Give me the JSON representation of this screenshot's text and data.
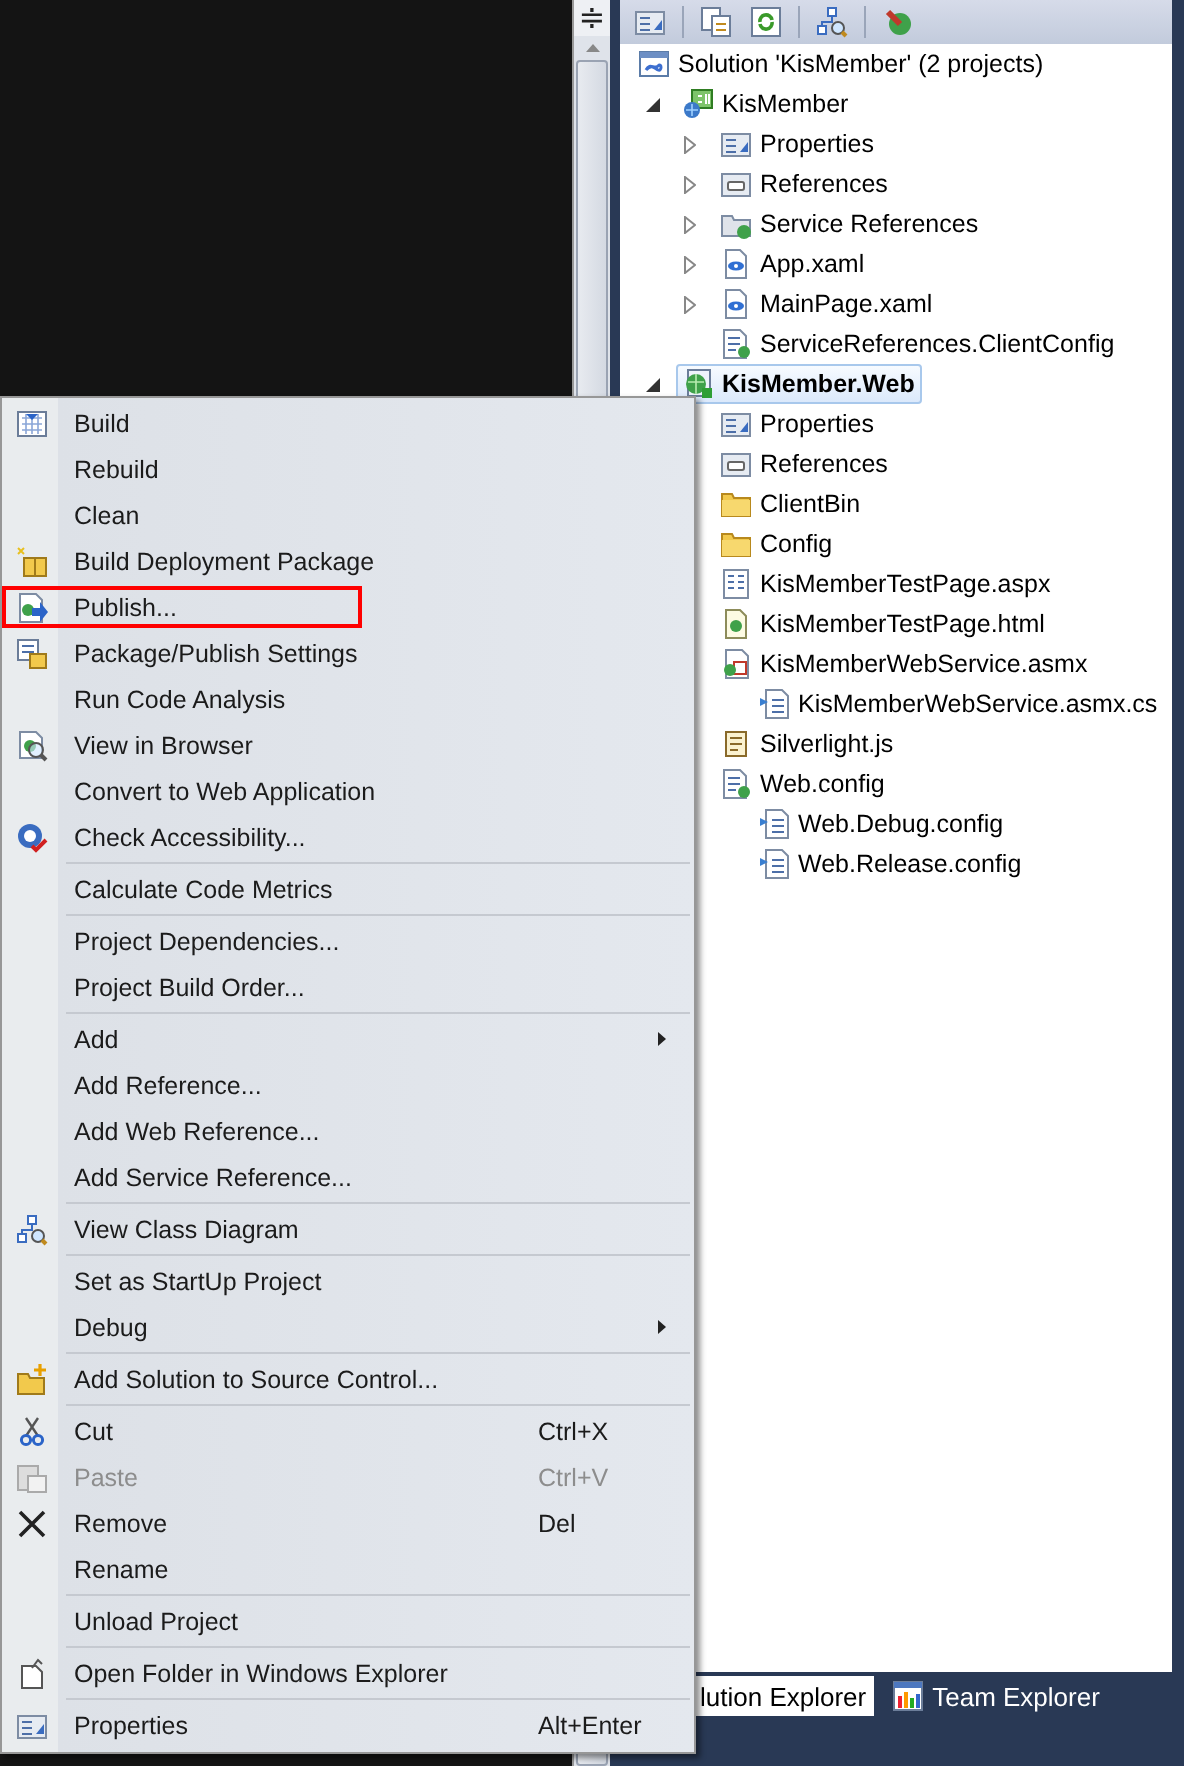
{
  "editor": {
    "splitter": "≑"
  },
  "solution_tree": {
    "items": [
      {
        "label": "Solution 'KisMember' (2 projects)",
        "kind": "solution",
        "selected": false,
        "startup": false,
        "children": [
          {
            "label": "KisMember",
            "kind": "cs-project",
            "selected": false,
            "startup": false,
            "expanded": true,
            "children": [
              {
                "label": "Properties",
                "kind": "properties",
                "selected": false,
                "startup": false,
                "expanded": false
              },
              {
                "label": "References",
                "kind": "references",
                "selected": false,
                "startup": false,
                "expanded": false
              },
              {
                "label": "Service References",
                "kind": "service-references",
                "selected": false,
                "startup": false,
                "expanded": false
              },
              {
                "label": "App.xaml",
                "kind": "xaml",
                "selected": false,
                "startup": false,
                "expanded": false
              },
              {
                "label": "MainPage.xaml",
                "kind": "xaml",
                "selected": false,
                "startup": false,
                "expanded": false
              },
              {
                "label": "ServiceReferences.ClientConfig",
                "kind": "config",
                "selected": false,
                "startup": false
              }
            ]
          },
          {
            "label": "KisMember.Web",
            "kind": "web-project",
            "selected": true,
            "startup": true,
            "expanded": true,
            "children": [
              {
                "label": "Properties",
                "kind": "properties",
                "selected": false,
                "startup": false
              },
              {
                "label": "References",
                "kind": "references",
                "selected": false,
                "startup": false
              },
              {
                "label": "ClientBin",
                "kind": "folder",
                "selected": false,
                "startup": false
              },
              {
                "label": "Config",
                "kind": "folder",
                "selected": false,
                "startup": false
              },
              {
                "label": "KisMemberTestPage.aspx",
                "kind": "aspx",
                "selected": false,
                "startup": false
              },
              {
                "label": "KisMemberTestPage.html",
                "kind": "html",
                "selected": false,
                "startup": false
              },
              {
                "label": "KisMemberWebService.asmx",
                "kind": "asmx",
                "selected": false,
                "startup": false,
                "children": [
                  {
                    "label": "KisMemberWebService.asmx.cs",
                    "kind": "code",
                    "selected": false,
                    "startup": false
                  }
                ]
              },
              {
                "label": "Silverlight.js",
                "kind": "script",
                "selected": false,
                "startup": false
              },
              {
                "label": "Web.config",
                "kind": "config",
                "selected": false,
                "startup": false,
                "children": [
                  {
                    "label": "Web.Debug.config",
                    "kind": "code",
                    "selected": false,
                    "startup": false
                  },
                  {
                    "label": "Web.Release.config",
                    "kind": "code",
                    "selected": false,
                    "startup": false
                  }
                ]
              }
            ]
          }
        ]
      }
    ]
  },
  "bottom_tabs": [
    {
      "label": "lution Explorer",
      "kind": "plain",
      "selected": true
    },
    {
      "label": "Team Explorer",
      "kind": "team",
      "selected": false
    }
  ],
  "context_menu": {
    "items": [
      {
        "kind": "build",
        "label": "Build",
        "disabled": false,
        "outlined": false
      },
      {
        "kind": "plain",
        "label": "Rebuild",
        "disabled": false,
        "outlined": false
      },
      {
        "kind": "plain",
        "label": "Clean",
        "disabled": false,
        "outlined": false
      },
      {
        "kind": "package",
        "label": "Build Deployment Package",
        "disabled": false,
        "outlined": false
      },
      {
        "kind": "publish",
        "label": "Publish...",
        "disabled": false,
        "outlined": true
      },
      {
        "kind": "package-settings",
        "label": "Package/Publish Settings",
        "disabled": false,
        "outlined": false
      },
      {
        "kind": "plain",
        "label": "Run Code Analysis",
        "disabled": false,
        "outlined": false
      },
      {
        "kind": "browser",
        "label": "View in Browser",
        "disabled": false,
        "outlined": false
      },
      {
        "kind": "plain",
        "label": "Convert to Web Application",
        "disabled": false,
        "outlined": false
      },
      {
        "kind": "accessibility",
        "label": "Check Accessibility...",
        "disabled": false,
        "outlined": false
      },
      {
        "kind": "separator"
      },
      {
        "kind": "plain",
        "label": "Calculate Code Metrics",
        "disabled": false,
        "outlined": false
      },
      {
        "kind": "separator"
      },
      {
        "kind": "plain",
        "label": "Project Dependencies...",
        "disabled": false,
        "outlined": false
      },
      {
        "kind": "plain",
        "label": "Project Build Order...",
        "disabled": false,
        "outlined": false
      },
      {
        "kind": "separator"
      },
      {
        "kind": "submenu",
        "label": "Add",
        "disabled": false,
        "outlined": false
      },
      {
        "kind": "plain",
        "label": "Add Reference...",
        "disabled": false,
        "outlined": false
      },
      {
        "kind": "plain",
        "label": "Add Web Reference...",
        "disabled": false,
        "outlined": false
      },
      {
        "kind": "plain",
        "label": "Add Service Reference...",
        "disabled": false,
        "outlined": false
      },
      {
        "kind": "separator"
      },
      {
        "kind": "class-diagram",
        "label": "View Class Diagram",
        "disabled": false,
        "outlined": false
      },
      {
        "kind": "separator"
      },
      {
        "kind": "plain",
        "label": "Set as StartUp Project",
        "disabled": false,
        "outlined": false
      },
      {
        "kind": "submenu",
        "label": "Debug",
        "disabled": false,
        "outlined": false
      },
      {
        "kind": "separator"
      },
      {
        "kind": "source-control",
        "label": "Add Solution to Source Control...",
        "disabled": false,
        "outlined": false
      },
      {
        "kind": "separator"
      },
      {
        "kind": "cut",
        "label": "Cut",
        "shortcut": "Ctrl+X",
        "disabled": false,
        "outlined": false
      },
      {
        "kind": "paste",
        "label": "Paste",
        "shortcut": "Ctrl+V",
        "disabled": true,
        "outlined": false
      },
      {
        "kind": "remove",
        "label": "Remove",
        "shortcut": "Del",
        "disabled": false,
        "outlined": false
      },
      {
        "kind": "plain",
        "label": "Rename",
        "disabled": false,
        "outlined": false
      },
      {
        "kind": "separator"
      },
      {
        "kind": "plain",
        "label": "Unload Project",
        "disabled": false,
        "outlined": false
      },
      {
        "kind": "separator"
      },
      {
        "kind": "open-folder",
        "label": "Open Folder in Windows Explorer",
        "disabled": false,
        "outlined": false
      },
      {
        "kind": "separator"
      },
      {
        "kind": "properties",
        "label": "Properties",
        "shortcut": "Alt+Enter",
        "disabled": false,
        "outlined": false
      }
    ]
  }
}
